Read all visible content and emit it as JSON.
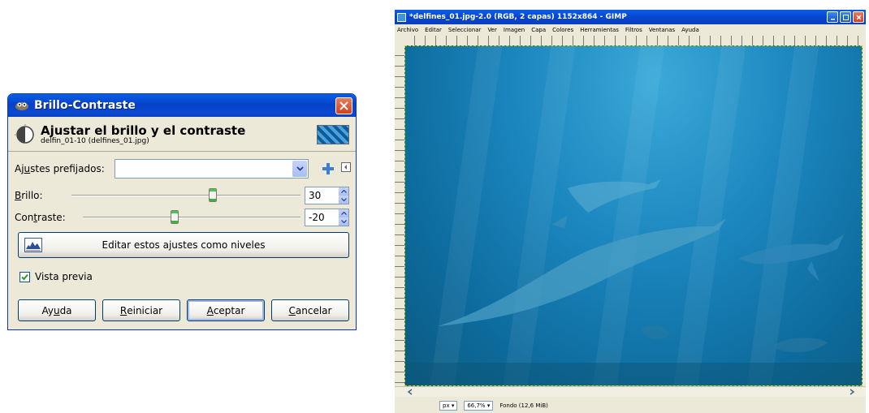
{
  "dialog": {
    "title": "Brillo-Contraste",
    "header_title": "Ajustar el brillo y el contraste",
    "header_subtitle": "delfin_01-10 (delfines_01.jpg)",
    "presets_label": "Ajustes prefijados:",
    "presets_value": "",
    "brightness_label": "Brillo:",
    "brightness_value": "30",
    "brightness_level": 30,
    "contrast_label": "Contraste:",
    "contrast_value": "-20",
    "contrast_level": -20,
    "edit_levels_button": "Editar estos ajustes como niveles",
    "preview_label": "Vista previa",
    "preview_checked": true,
    "buttons": {
      "help": "Ayuda",
      "reset": "Reiniciar",
      "ok": "Aceptar",
      "cancel": "Cancelar"
    },
    "colors": {
      "titlebar": "#0a48d2",
      "handle_green": "#3bb33b"
    }
  },
  "gimp": {
    "title": "*delfines_01.jpg-2.0 (RGB, 2 capas) 1152x864 - GIMP",
    "menu": [
      "Archivo",
      "Editar",
      "Seleccionar",
      "Ver",
      "Imagen",
      "Capa",
      "Colores",
      "Herramientas",
      "Filtros",
      "Ventanas",
      "Ayuda"
    ],
    "status_unit": "px",
    "status_zoom": "66,7%",
    "status_layer": "Fondo (12,6 MiB)"
  }
}
